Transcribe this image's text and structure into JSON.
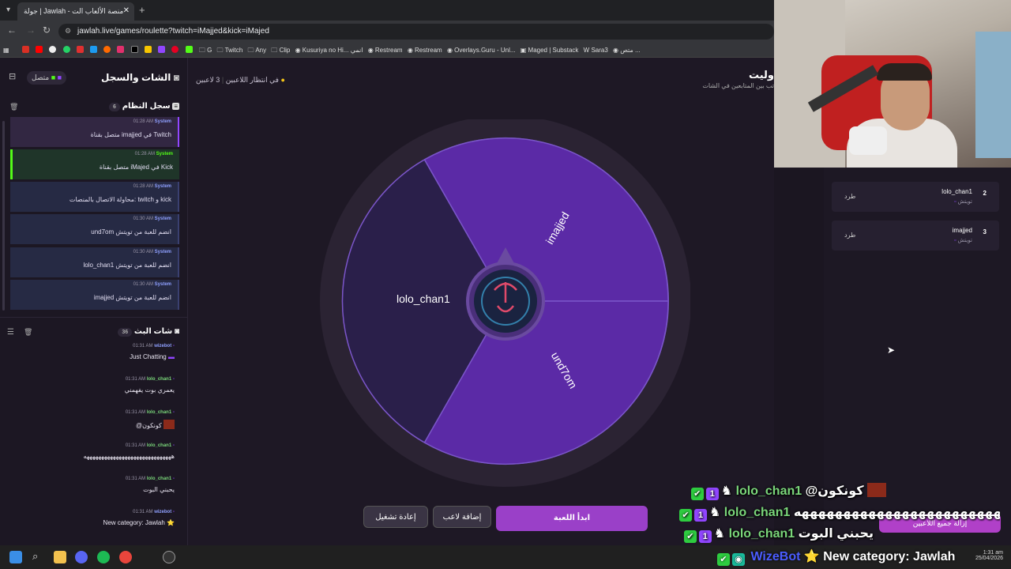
{
  "browser": {
    "tab_title": "جولة | Jawlah - منصة الألعاب الت",
    "url": "jawlah.live/games/roulette?twitch=iMajjed&kick=iMajed",
    "bookmarks": [
      "G",
      "Twitch",
      "Any",
      "Clip",
      "Kusuriya no Hi... انمي",
      "Restream",
      "Restream",
      "Overlays.Guru - Unl...",
      "Maged | Substack",
      "Sara3",
      "متص ..."
    ]
  },
  "sidebar": {
    "title": "الشات والسجل",
    "status": "متصل",
    "syslog": {
      "title": "سجل النظام",
      "count": "6",
      "messages": [
        {
          "time": "01:28 AM",
          "user": "System",
          "text": "متصل بقناة imajjed في Twitch"
        },
        {
          "time": "01:28 AM",
          "user": "System",
          "text": "متصل بقناة iMajed في Kick"
        },
        {
          "time": "01:28 AM",
          "user": "System",
          "text": "محاولة الاتصال بالمنصات: twitch و kick"
        },
        {
          "time": "01:30 AM",
          "user": "System",
          "text": "und7om انضم للعبة من تويتش"
        },
        {
          "time": "01:30 AM",
          "user": "System",
          "text": "lolo_chan1 انضم للعبة من تويتش"
        },
        {
          "time": "01:30 AM",
          "user": "System",
          "text": "imajjed انضم للعبة من تويتش"
        }
      ]
    },
    "chat": {
      "title": "شات البث",
      "count": "36",
      "messages": [
        {
          "time": "01:31 AM",
          "user": "wizebot",
          "text": "Just Chatting"
        },
        {
          "time": "01:31 AM",
          "user": "lolo_chan1",
          "text": "يعمري بوت يفهمني"
        },
        {
          "time": "01:31 AM",
          "user": "lolo_chan1",
          "text": "@كونكون"
        },
        {
          "time": "01:31 AM",
          "user": "lolo_chan1",
          "text": "ههههههههههههههههههههههههههههههه"
        },
        {
          "time": "01:31 AM",
          "user": "lolo_chan1",
          "text": "يحبني البوت"
        },
        {
          "time": "01:31 AM",
          "user": "wizebot",
          "text": "New category: Jawlah ⭐"
        }
      ]
    }
  },
  "main": {
    "players_count": "3 لاعبين",
    "waiting": "في انتظار اللاعبين",
    "title": "ولیت",
    "subtitle": "تب بين المتابعين في الشات"
  },
  "wheel": {
    "segments": [
      "lolo_chan1",
      "imajjed",
      "und7om"
    ]
  },
  "players": [
    {
      "rank": "2",
      "name": "lolo_chan1",
      "platform": "تويتش",
      "kick": "طرد"
    },
    {
      "rank": "3",
      "name": "imajjed",
      "platform": "تويتش",
      "kick": "طرد"
    }
  ],
  "buttons": {
    "start": "ابدأ اللعبة",
    "add_player": "إضافة لاعب",
    "restart": "إعادة تشغيل",
    "remove_all": "إزالة جميع اللاعبين"
  },
  "overlay": {
    "lines": [
      {
        "user": "lolo_chan1",
        "text": "@كونكون"
      },
      {
        "user": "lolo_chan1",
        "text": "هههههههههههههههههههههههههههههههه"
      },
      {
        "user": "lolo_chan1",
        "text": "يحبني البوت"
      },
      {
        "user": "WizeBot",
        "text": "⭐ New category: Jawlah"
      }
    ]
  },
  "taskbar": {
    "time": "1:31 am",
    "date": "25/04/2026"
  },
  "colors": {
    "accent": "#7a3fc4",
    "purple_segment": "#5b2aa6",
    "dark_segment": "#2a1f4a"
  }
}
